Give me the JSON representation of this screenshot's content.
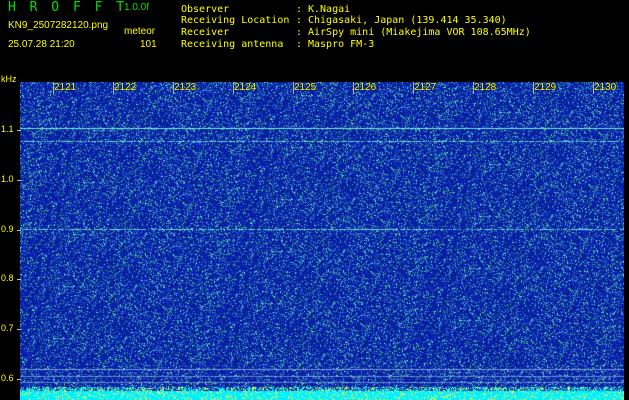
{
  "header": {
    "app_title": "H R O F F T",
    "version": "1.0.0f",
    "filename": "KN9_2507282120.png",
    "mode": "meteor",
    "datetime": "25.07.28 21:20",
    "count": "101"
  },
  "info": [
    {
      "label": "Observer",
      "value": "K.Nagai"
    },
    {
      "label": "Receiving Location",
      "value": "Chigasaki, Japan (139.414 35.340)"
    },
    {
      "label": "Receiver",
      "value": "AirSpy mini (Miakejima VOR 108.65MHz)"
    },
    {
      "label": "Receiving antenna",
      "value": "Maspro FM-3"
    }
  ],
  "y_axis": {
    "unit": "kHz",
    "ticks": [
      "1.1",
      "1.0",
      "0.9",
      "0.8",
      "0.7",
      "0.6"
    ]
  },
  "x_axis": {
    "ticks": [
      "2121",
      "2122",
      "2123",
      "2124",
      "2125",
      "2126",
      "2127",
      "2128",
      "2129",
      "2130"
    ]
  },
  "colors": {
    "background": "#000000",
    "label": "#ffff00",
    "title": "#00e000",
    "spectrogram_base": "#0a1ea8",
    "carrier": "#40e0d0",
    "noise_floor": "#00ffff"
  }
}
